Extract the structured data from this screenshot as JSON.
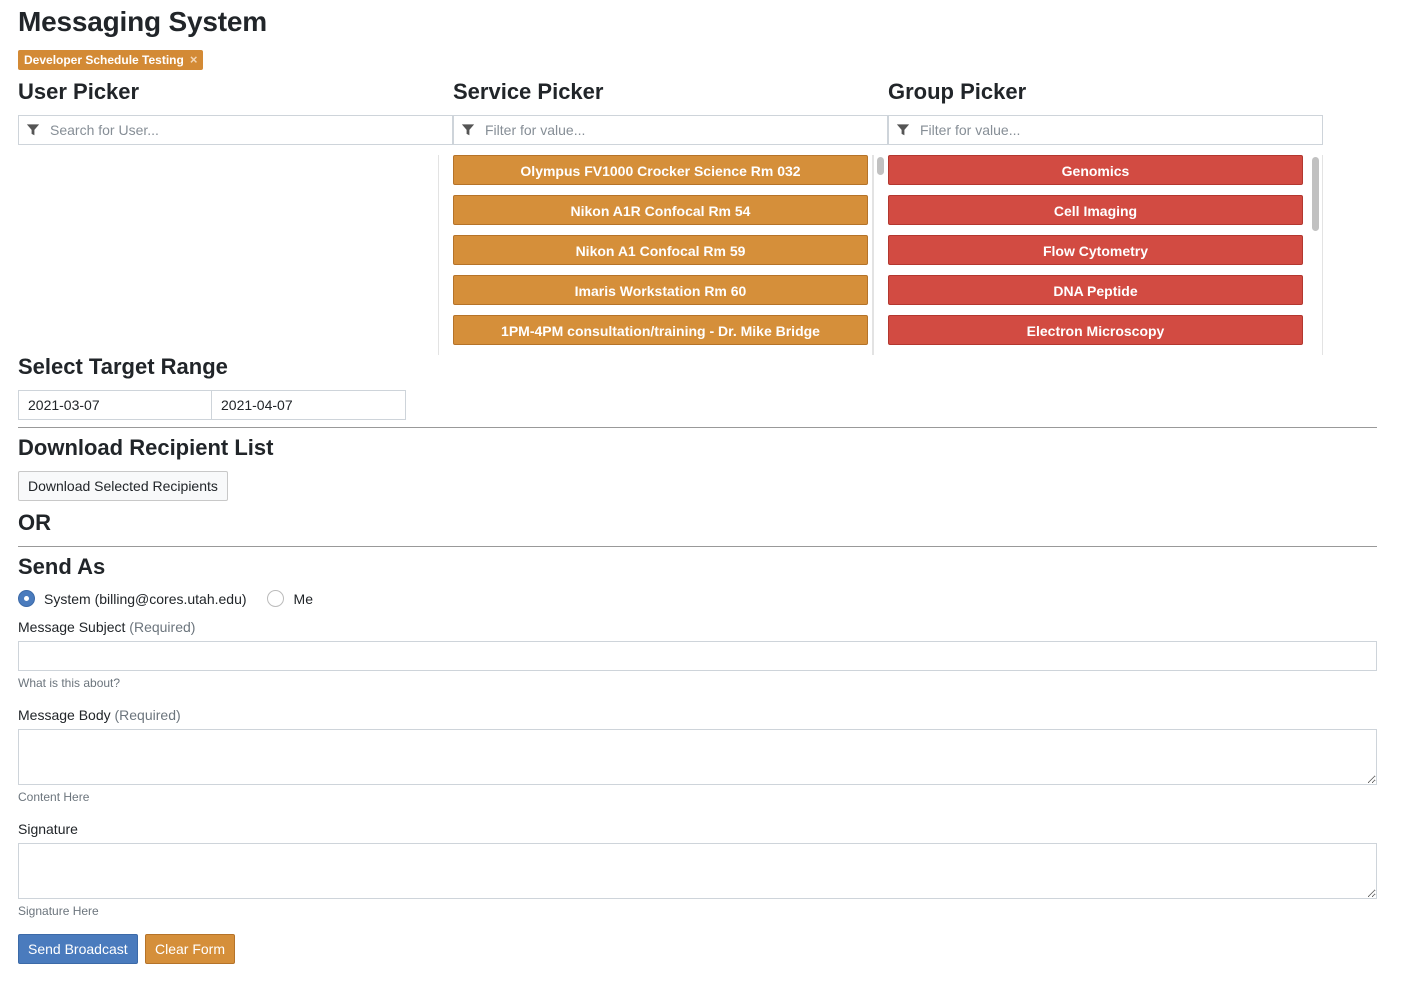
{
  "page": {
    "title": "Messaging System"
  },
  "tag": {
    "label": "Developer Schedule Testing",
    "remove": "×"
  },
  "user_picker": {
    "title": "User Picker",
    "placeholder": "Search for User..."
  },
  "service_picker": {
    "title": "Service Picker",
    "placeholder": "Filter for value...",
    "items": [
      "Olympus FV1000 Crocker Science Rm 032",
      "Nikon A1R Confocal Rm 54",
      "Nikon A1 Confocal Rm 59",
      "Imaris Workstation Rm 60",
      "1PM-4PM consultation/training - Dr. Mike Bridge"
    ]
  },
  "group_picker": {
    "title": "Group Picker",
    "placeholder": "Filter for value...",
    "items": [
      "Genomics",
      "Cell Imaging",
      "Flow Cytometry",
      "DNA Peptide",
      "Electron Microscopy"
    ]
  },
  "target_range": {
    "title": "Select Target Range",
    "start": "2021-03-07",
    "end": "2021-04-07"
  },
  "download": {
    "title": "Download Recipient List",
    "button": "Download Selected Recipients"
  },
  "or_label": "OR",
  "send_as": {
    "title": "Send As",
    "options": [
      {
        "label": "System (billing@cores.utah.edu)",
        "selected": true
      },
      {
        "label": "Me",
        "selected": false
      }
    ]
  },
  "subject": {
    "label": "Message Subject",
    "required": "(Required)",
    "help": "What is this about?",
    "value": ""
  },
  "body": {
    "label": "Message Body",
    "required": "(Required)",
    "help": "Content Here",
    "value": ""
  },
  "signature": {
    "label": "Signature",
    "help": "Signature Here",
    "value": ""
  },
  "actions": {
    "send": "Send Broadcast",
    "clear": "Clear Form"
  },
  "colors": {
    "service_button": "#d58f3a",
    "group_button": "#d24b42",
    "primary": "#4a7bbd"
  },
  "icons": {
    "filter": "filter-icon"
  }
}
